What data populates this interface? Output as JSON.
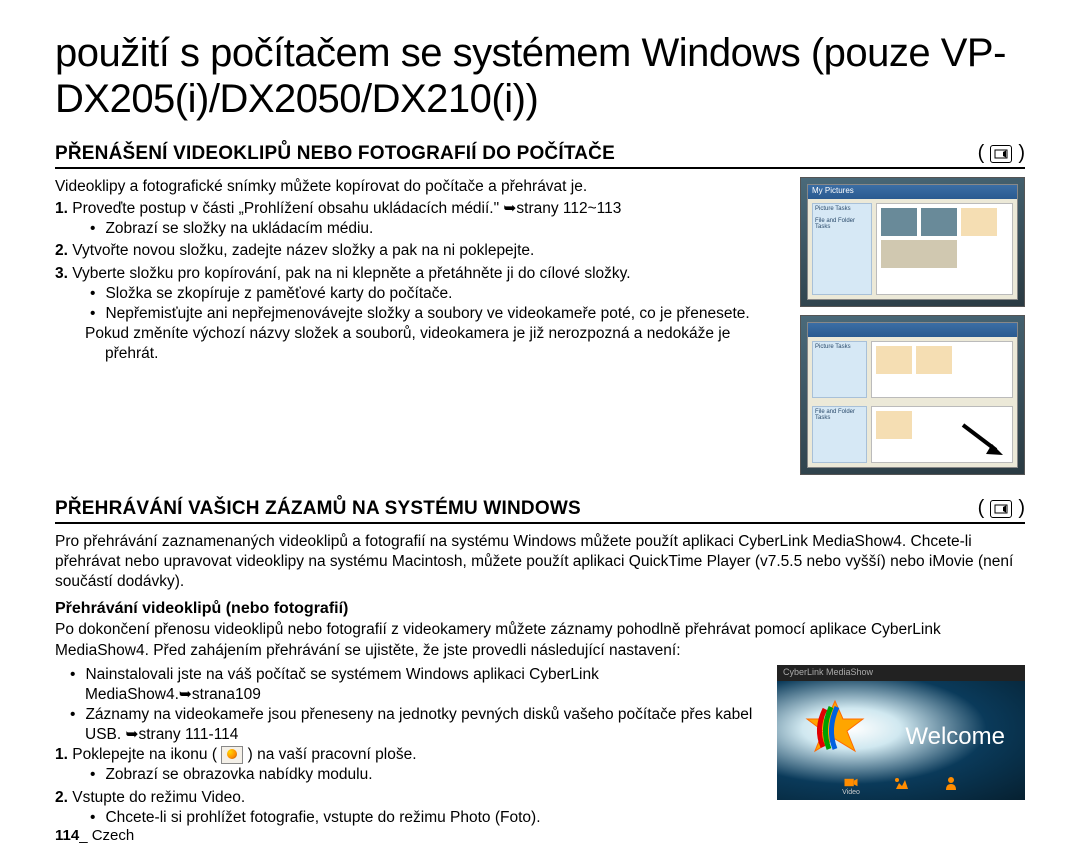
{
  "title": "použití s počítačem se systémem Windows (pouze VP-DX205(i)/DX2050/DX210(i))",
  "section1": {
    "heading": "PŘENÁŠENÍ VIDEOKLIPŮ NEBO FOTOGRAFIÍ DO POČÍTAČE",
    "intro": "Videoklipy a fotografické snímky můžete kopírovat do počítače a přehrávat je.",
    "step1_num": "1.",
    "step1": "Proveďte postup v části „Prohlížení obsahu ukládacích médií.\" ➥strany 112~113",
    "step1_b1": "Zobrazí se složky na ukládacím médiu.",
    "step2_num": "2.",
    "step2": "Vytvořte novou složku, zadejte název složky a pak na ni poklepejte.",
    "step3_num": "3.",
    "step3": "Vyberte složku pro kopírování, pak na ni klepněte a přetáhněte ji do cílové složky.",
    "step3_b1": "Složka se zkopíruje z paměťové karty do počítače.",
    "step3_b2": "Nepřemisťujte ani nepřejmenovávejte složky a soubory ve videokameře poté, co je přenesete.",
    "step3_note": "Pokud změníte výchozí názvy složek a souborů, videokamera je již nerozpozná a nedokáže je přehrát.",
    "win_title1": "My Pictures",
    "win_side1a": "Picture Tasks",
    "win_side1b": "File and Folder Tasks"
  },
  "section2": {
    "heading": "PŘEHRÁVÁNÍ VAŠICH ZÁZAMŮ NA SYSTÉMU WINDOWS",
    "intro": "Pro přehrávání zaznamenaných videoklipů a fotografií na systému Windows můžete použít aplikaci CyberLink MediaShow4. Chcete-li přehrávat nebo upravovat videoklipy na systému Macintosh, můžete použít aplikaci QuickTime Player (v7.5.5 nebo vyšší) nebo iMovie (není součástí dodávky).",
    "subheading": "Přehrávání videoklipů (nebo fotografií)",
    "para": "Po dokončení přenosu videoklipů nebo fotografií z videokamery můžete záznamy pohodlně přehrávat pomocí aplikace CyberLink MediaShow4. Před zahájením přehrávání se ujistěte, že jste provedli následující nastavení:",
    "b1": "Nainstalovali jste na váš počítač se systémem Windows aplikaci CyberLink MediaShow4.➥strana109",
    "b2": "Záznamy na videokameře jsou přeneseny na jednotky pevných disků vašeho počítače přes kabel USB. ➥strany 111-114",
    "step1_num": "1.",
    "step1_a": "Poklepejte na ikonu (",
    "step1_b": ") na vaší pracovní ploše.",
    "step1_b1": "Zobrazí se obrazovka nabídky modulu.",
    "step2_num": "2.",
    "step2": "Vstupte do režimu Video.",
    "step2_b1": "Chcete-li si prohlížet fotografie, vstupte do režimu Photo (Foto).",
    "welcome_header": "CyberLink MediaShow",
    "welcome_text": "Welcome",
    "welcome_label": "Video"
  },
  "footer": {
    "page": "114",
    "sep": "_",
    "lang": "Czech"
  }
}
